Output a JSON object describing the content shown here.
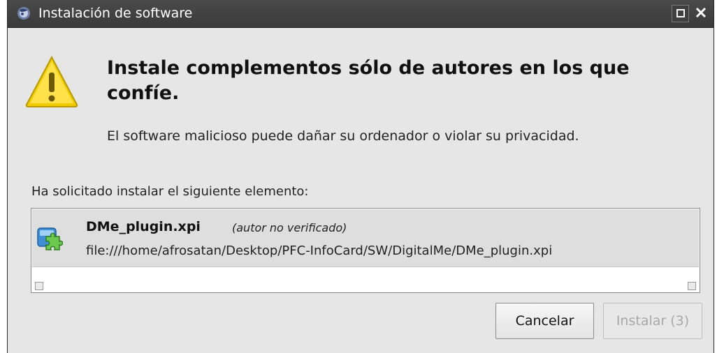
{
  "window": {
    "title": "Instalación de software"
  },
  "dialog": {
    "headline": "Instale complementos sólo de autores en los que confíe.",
    "subtext": "El software malicioso puede dañar su ordenador o violar su privacidad.",
    "request_label": "Ha solicitado instalar el siguiente elemento:"
  },
  "items": [
    {
      "name": "DMe_plugin.xpi",
      "author": "(autor no verificado)",
      "url": "file:///home/afrosatan/Desktop/PFC-InfoCard/SW/DigitalMe/DMe_plugin.xpi",
      "icon": "puzzle-piece-icon"
    }
  ],
  "buttons": {
    "cancel": "Cancelar",
    "install": "Instalar (3)"
  },
  "icons": {
    "app": "app-logo-icon",
    "warning": "warning-triangle-icon",
    "maximize": "maximize-icon",
    "close": "close-icon"
  },
  "colors": {
    "titlebar": "#3f3f3f",
    "dialog_bg": "#e6e6e6",
    "warning_yellow": "#f5d200",
    "disabled_text": "#a8a8a8"
  }
}
